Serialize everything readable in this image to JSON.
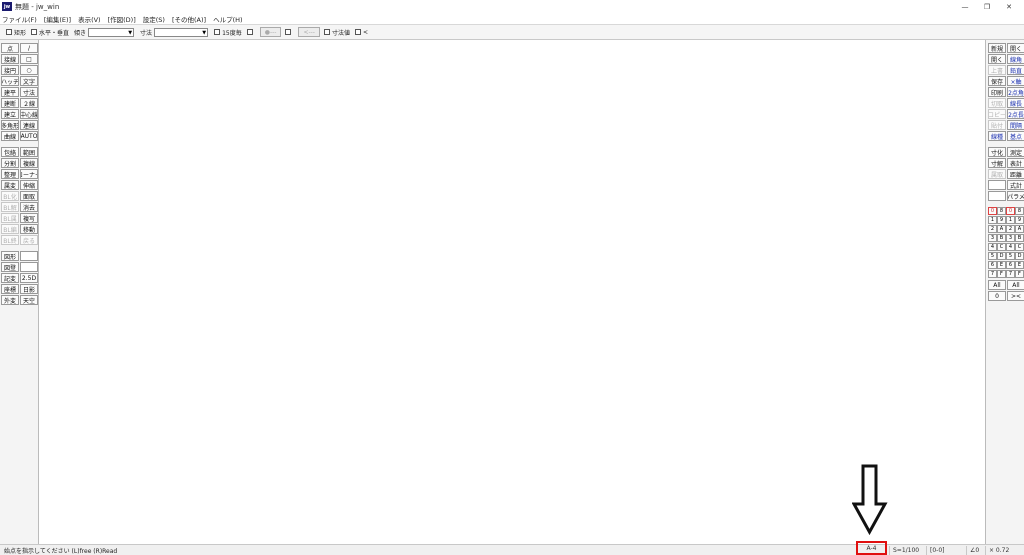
{
  "window": {
    "title": "無題 - jw_win",
    "app_icon_text": "jw",
    "controls": [
      "—",
      "❐",
      "✕"
    ]
  },
  "menu": [
    "ファイル(F)",
    "[編集(E)]",
    "表示(V)",
    "[作図(D)]",
    "設定(S)",
    "[その他(A)]",
    "ヘルプ(H)"
  ],
  "toolbar": {
    "rect_label": "矩形",
    "hv_label": "水平・垂直",
    "tilt_label": "傾き",
    "dim_label": "寸法",
    "deg15_label": "15度毎",
    "dim_btn1": "●---",
    "dim_btn2": "<---",
    "dimval_label": "寸法値",
    "arrow_label": "<"
  },
  "left_tools": [
    "点",
    "/",
    "接線",
    "□",
    "接円",
    "○",
    "ハッチ",
    "文字",
    "建平",
    "寸法",
    "建断",
    "２線",
    "建立",
    "中心線",
    "多角形",
    "連線",
    "曲線",
    "AUTO",
    "",
    "",
    "包絡",
    "範囲",
    "分割",
    "複線",
    "整理",
    "コーナー",
    "属変",
    "伸縮",
    "BL化",
    "面取",
    "BL解",
    "消去",
    "BL属",
    "複写",
    "BL編",
    "移動",
    "BL終",
    "戻る",
    "",
    "",
    "図形",
    "",
    "図登",
    "",
    "記変",
    "2.5D",
    "座標",
    "日影",
    "外変",
    "天空"
  ],
  "right_tools": [
    "新規",
    "開く",
    "開く",
    "線角",
    "上書",
    "鉛直",
    "保存",
    "×軸",
    "印刷",
    "2点角",
    "切取",
    "線長",
    "コピー",
    "2点長",
    "貼付",
    "間隔",
    "線種",
    "基点",
    "",
    "",
    "寸化",
    "測定",
    "寸解",
    "表計",
    "属取",
    "距離",
    "",
    "式計",
    "",
    "パラメ"
  ],
  "layers": [
    [
      "0",
      "8",
      "0",
      "8"
    ],
    [
      "1",
      "9",
      "1",
      "9"
    ],
    [
      "2",
      "A",
      "2",
      "A"
    ],
    [
      "3",
      "B",
      "3",
      "B"
    ],
    [
      "4",
      "C",
      "4",
      "C"
    ],
    [
      "5",
      "D",
      "5",
      "D"
    ],
    [
      "6",
      "E",
      "6",
      "E"
    ],
    [
      "7",
      "F",
      "7",
      "F"
    ]
  ],
  "layer_all_left": "All",
  "layer_all_right": "All",
  "layer_bottom_left": "0",
  "layer_bottom_right": "><",
  "status": {
    "message": "始点を指示してください (L)free (R)Read",
    "paper": "A-4",
    "scale": "S=1/100",
    "layer": "[0-0]",
    "angle": "∠0",
    "zoom": "× 0.72"
  }
}
